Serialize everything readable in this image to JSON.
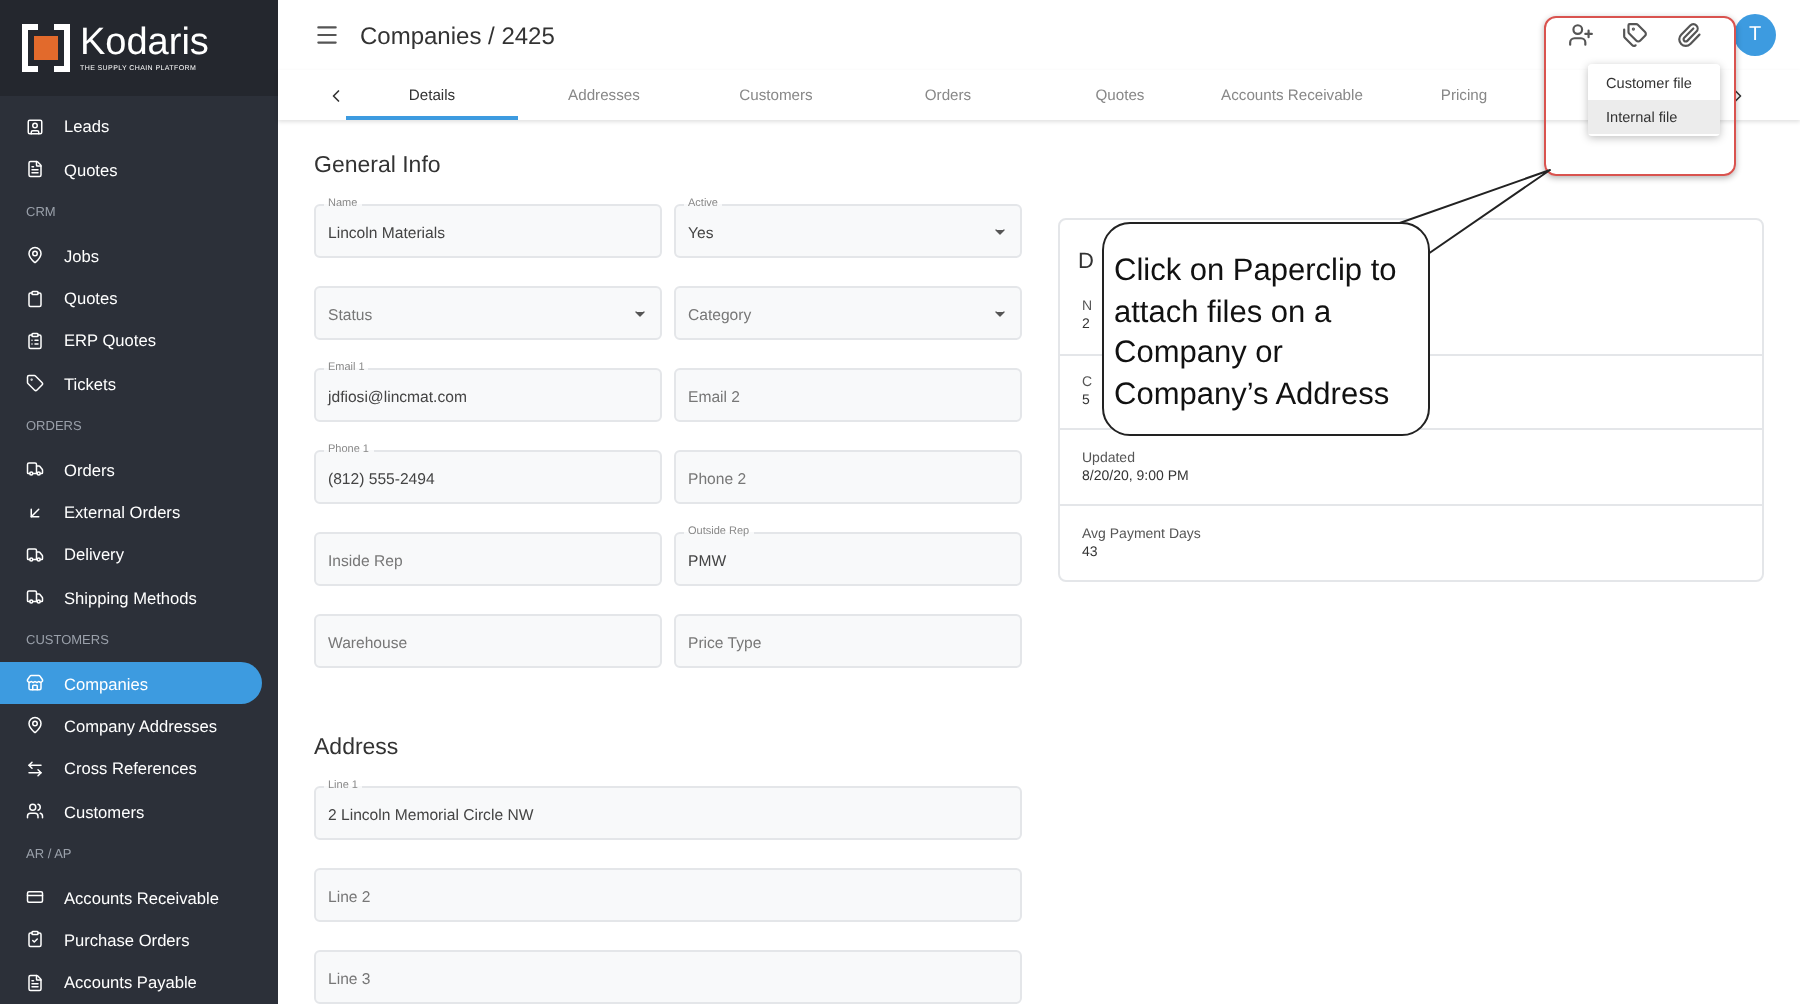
{
  "sidebar": {
    "logo": {
      "name": "Kodaris",
      "tagline": "THE SUPPLY CHAIN PLATFORM"
    },
    "items": [
      {
        "kind": "item",
        "label": "Leads",
        "selected": false
      },
      {
        "kind": "item",
        "label": "Quotes",
        "selected": false
      },
      {
        "kind": "section",
        "label": "CRM"
      },
      {
        "kind": "item",
        "label": "Jobs",
        "selected": false
      },
      {
        "kind": "item",
        "label": "Quotes",
        "selected": false
      },
      {
        "kind": "item",
        "label": "ERP Quotes",
        "selected": false
      },
      {
        "kind": "item",
        "label": "Tickets",
        "selected": false
      },
      {
        "kind": "section",
        "label": "ORDERS"
      },
      {
        "kind": "item",
        "label": "Orders",
        "selected": false
      },
      {
        "kind": "item",
        "label": "External Orders",
        "selected": false
      },
      {
        "kind": "item",
        "label": "Delivery",
        "selected": false
      },
      {
        "kind": "item",
        "label": "Shipping Methods",
        "selected": false
      },
      {
        "kind": "section",
        "label": "CUSTOMERS"
      },
      {
        "kind": "item",
        "label": "Companies",
        "selected": true
      },
      {
        "kind": "item",
        "label": "Company Addresses",
        "selected": false
      },
      {
        "kind": "item",
        "label": "Cross References",
        "selected": false
      },
      {
        "kind": "item",
        "label": "Customers",
        "selected": false
      },
      {
        "kind": "section",
        "label": "AR / AP"
      },
      {
        "kind": "item",
        "label": "Accounts Receivable",
        "selected": false
      },
      {
        "kind": "item",
        "label": "Purchase Orders",
        "selected": false
      },
      {
        "kind": "item",
        "label": "Accounts Payable",
        "selected": false
      }
    ]
  },
  "header": {
    "title": "Companies / 2425",
    "avatar": "T"
  },
  "tabs": [
    {
      "label": "Details",
      "selected": true
    },
    {
      "label": "Addresses",
      "selected": false
    },
    {
      "label": "Customers",
      "selected": false
    },
    {
      "label": "Orders",
      "selected": false
    },
    {
      "label": "Quotes",
      "selected": false
    },
    {
      "label": "Accounts Receivable",
      "selected": false
    },
    {
      "label": "Pricing",
      "selected": false
    }
  ],
  "file_menu": [
    {
      "label": "Customer file",
      "selected": false
    },
    {
      "label": "Internal file",
      "selected": true
    }
  ],
  "general_info": {
    "title": "General Info",
    "rows": [
      [
        {
          "kind": "text",
          "label": "Name",
          "value": "Lincoln Materials"
        },
        {
          "kind": "select",
          "label": "Active",
          "value": "Yes"
        }
      ],
      [
        {
          "kind": "select",
          "placeholder": "Status"
        },
        {
          "kind": "select",
          "placeholder": "Category"
        }
      ],
      [
        {
          "kind": "text",
          "label": "Email 1",
          "value": "jdfiosi@lincmat.com"
        },
        {
          "kind": "text",
          "placeholder": "Email 2"
        }
      ],
      [
        {
          "kind": "text",
          "label": "Phone 1",
          "value": "(812) 555-2494"
        },
        {
          "kind": "text",
          "placeholder": "Phone 2"
        }
      ],
      [
        {
          "kind": "text",
          "placeholder": "Inside Rep"
        },
        {
          "kind": "text",
          "label": "Outside Rep",
          "value": "PMW"
        }
      ],
      [
        {
          "kind": "text",
          "placeholder": "Warehouse"
        },
        {
          "kind": "text",
          "placeholder": "Price Type"
        }
      ]
    ]
  },
  "address": {
    "title": "Address",
    "fields": [
      {
        "label": "Line 1",
        "value": "2 Lincoln Memorial Circle NW"
      },
      {
        "placeholder": "Line 2"
      },
      {
        "placeholder": "Line 3"
      }
    ]
  },
  "details_card": {
    "heading": "D",
    "rows": [
      {
        "label": "N",
        "value": "2"
      },
      {
        "label": "C",
        "value": "5"
      },
      {
        "label": "Updated",
        "value": "8/20/20, 9:00 PM"
      },
      {
        "label": "Avg Payment Days",
        "value": "43"
      }
    ]
  },
  "callout": {
    "text": "Click on Paperclip to attach files on a Company or Company’s Address"
  }
}
